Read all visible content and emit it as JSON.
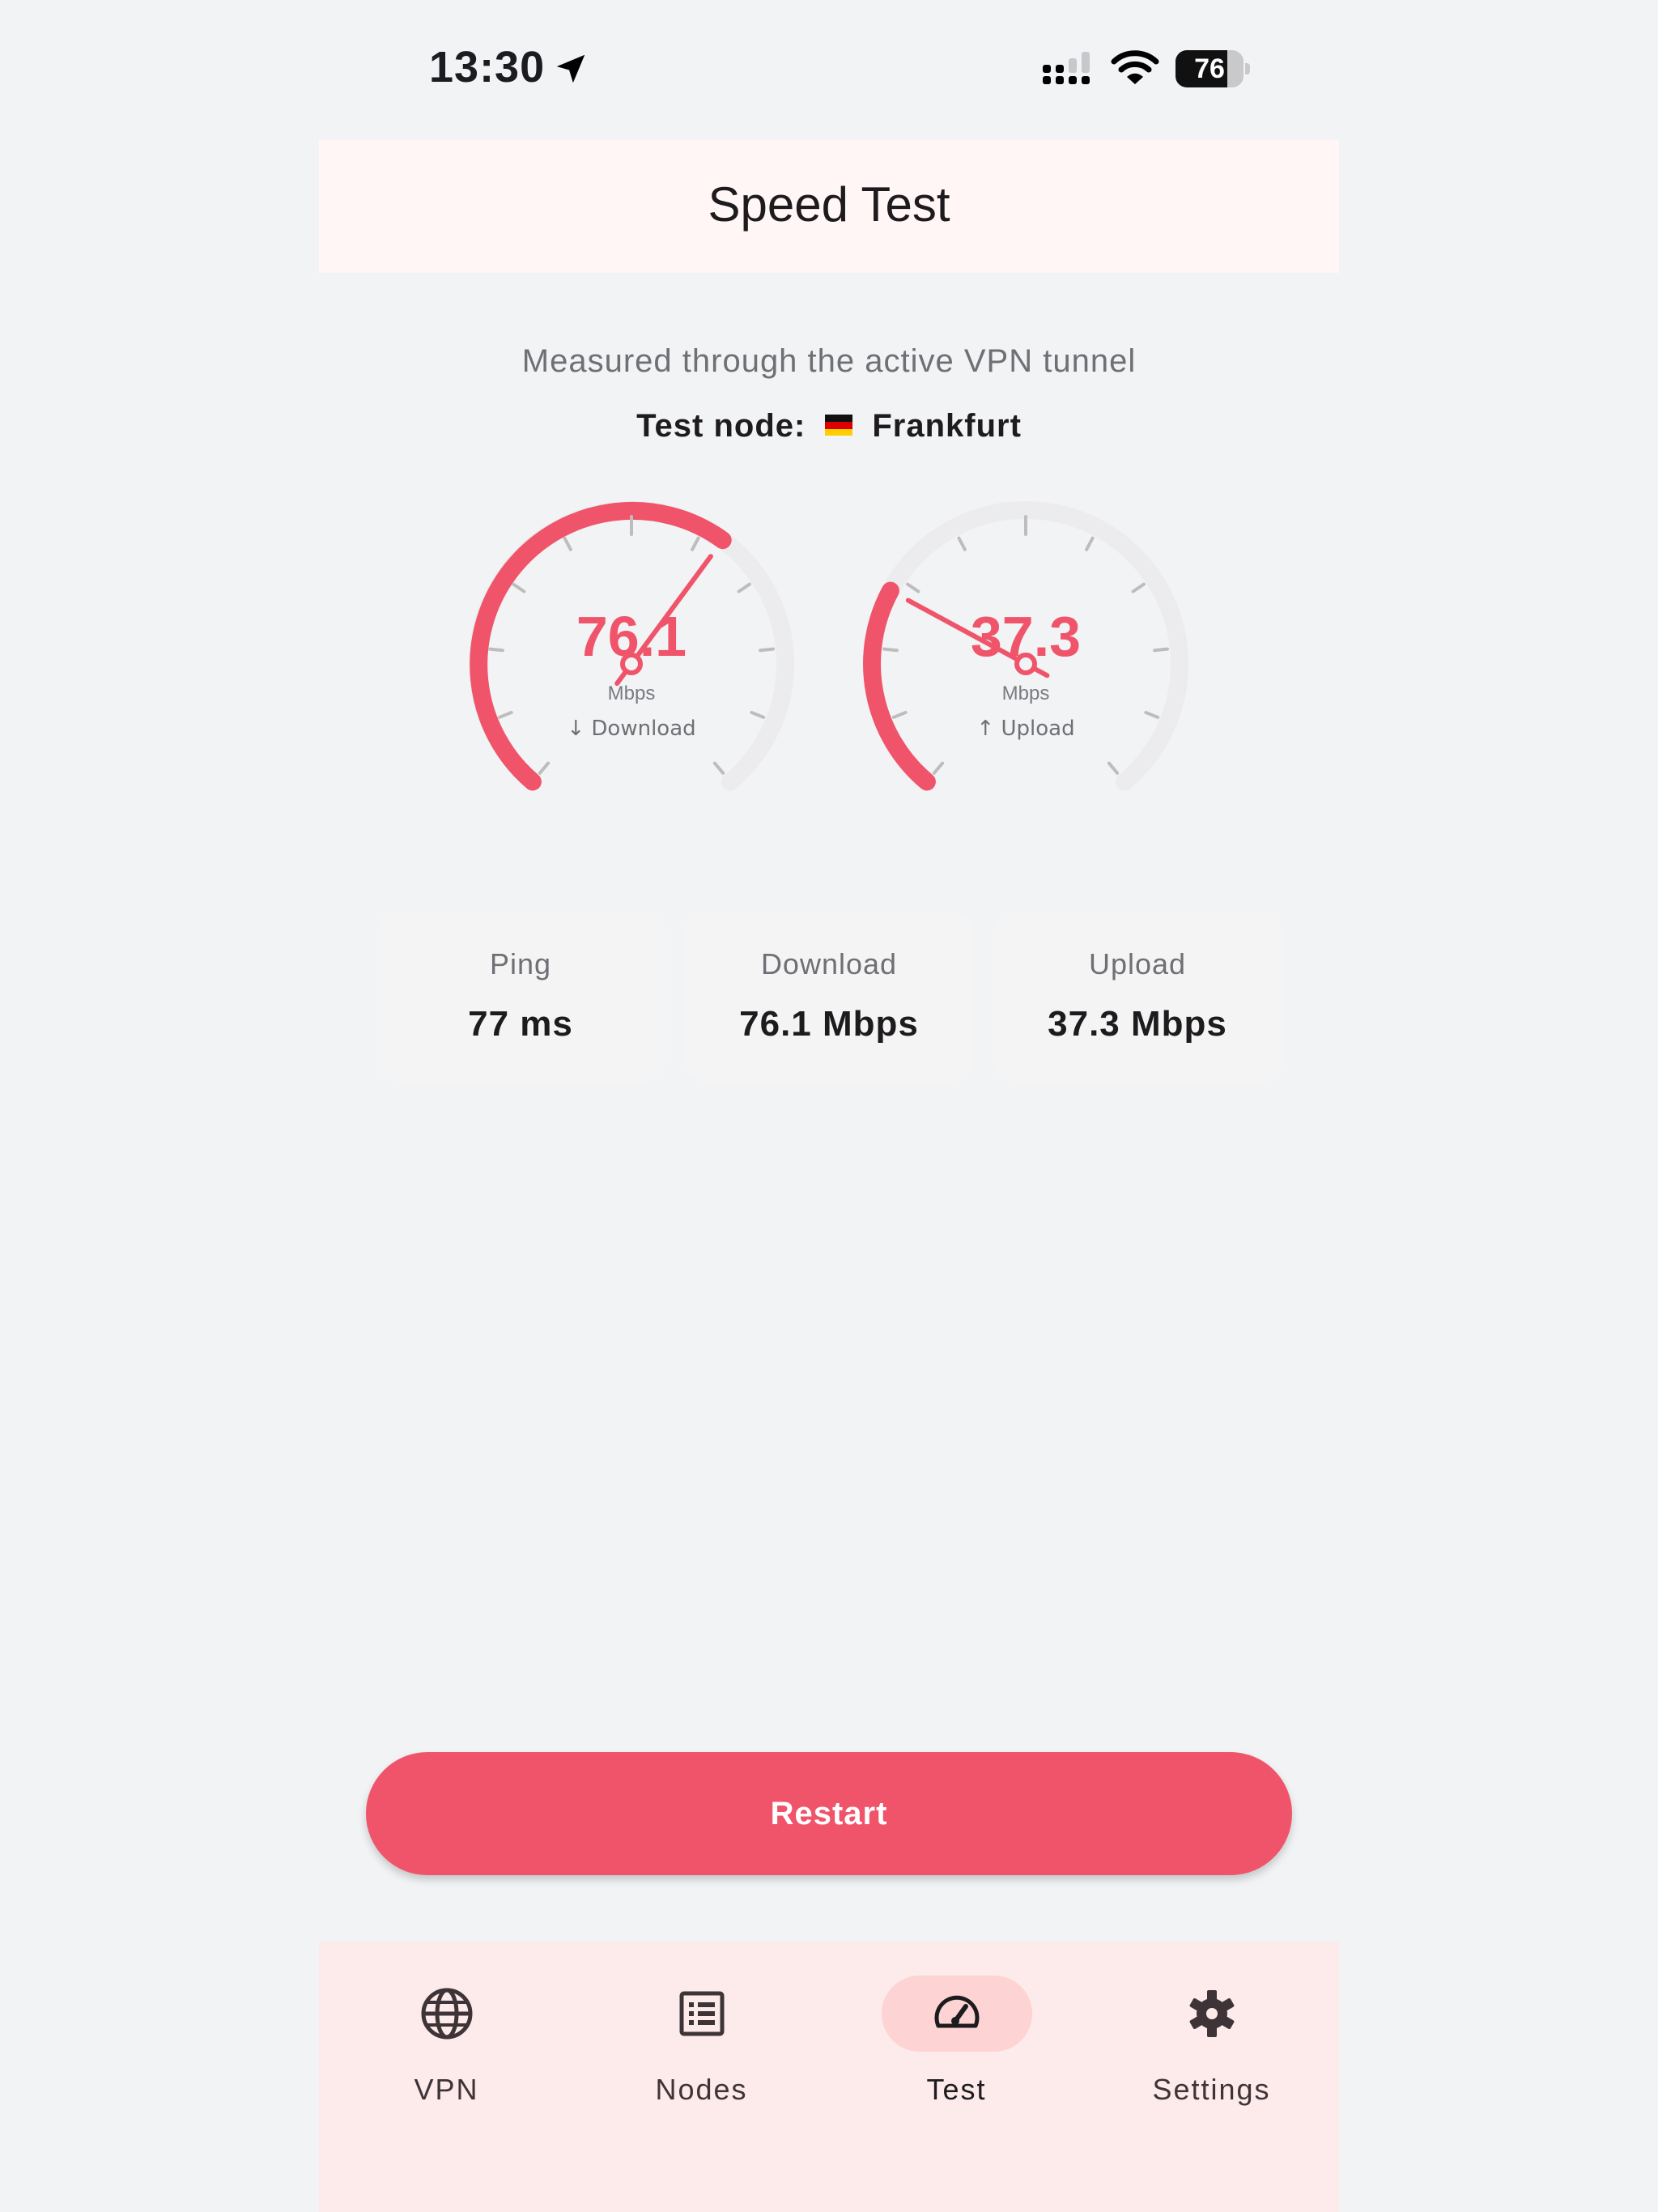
{
  "status_bar": {
    "time": "13:30",
    "battery_level": "76",
    "battery_fraction": 0.76,
    "icons": [
      "location-arrow-icon",
      "cellular-signal-icon",
      "wifi-icon",
      "battery-icon"
    ]
  },
  "header": {
    "title": "Speed Test"
  },
  "info": {
    "subtitle": "Measured through the active VPN tunnel",
    "node_label": "Test node:",
    "node_flag": "germany-flag-icon",
    "node_name": "Frankfurt"
  },
  "gauges": {
    "download": {
      "value": "76.1",
      "unit": "Mbps",
      "label": "↓ Download",
      "fraction": 0.63
    },
    "upload": {
      "value": "37.3",
      "unit": "Mbps",
      "label": "↑ Upload",
      "fraction": 0.28
    }
  },
  "stats": [
    {
      "label": "Ping",
      "value": "77 ms"
    },
    {
      "label": "Download",
      "value": "76.1 Mbps"
    },
    {
      "label": "Upload",
      "value": "37.3 Mbps"
    }
  ],
  "actions": {
    "restart_label": "Restart"
  },
  "nav": {
    "items": [
      {
        "label": "VPN",
        "icon": "globe-icon",
        "active": false
      },
      {
        "label": "Nodes",
        "icon": "list-icon",
        "active": false
      },
      {
        "label": "Test",
        "icon": "speedometer-icon",
        "active": true
      },
      {
        "label": "Settings",
        "icon": "gear-icon",
        "active": false
      }
    ]
  },
  "colors": {
    "accent": "#f0546a",
    "track": "#ececee",
    "tick": "#bdbdbd",
    "app_bar_bg": "#fff6f5",
    "nav_bg": "#fdeaea",
    "nav_active_pill": "#fdd3d3"
  }
}
